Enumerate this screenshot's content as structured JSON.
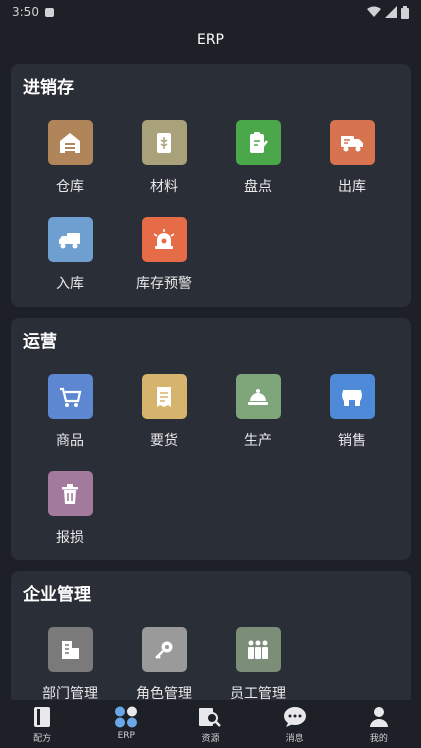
{
  "status": {
    "time": "3:50"
  },
  "header": {
    "title": "ERP"
  },
  "sections": [
    {
      "title": "进销存",
      "items": [
        {
          "label": "仓库",
          "icon": "warehouse-icon",
          "color": "#b0855a"
        },
        {
          "label": "材料",
          "icon": "material-icon",
          "color": "#a8a17a"
        },
        {
          "label": "盘点",
          "icon": "inventory-check-icon",
          "color": "#4aa84a"
        },
        {
          "label": "出库",
          "icon": "outbound-truck-icon",
          "color": "#d8734f"
        },
        {
          "label": "入库",
          "icon": "inbound-truck-icon",
          "color": "#6f9fd0"
        },
        {
          "label": "库存预警",
          "icon": "alarm-icon",
          "color": "#e66c48"
        }
      ]
    },
    {
      "title": "运营",
      "items": [
        {
          "label": "商品",
          "icon": "cart-icon",
          "color": "#5d87d0"
        },
        {
          "label": "要货",
          "icon": "receipt-icon",
          "color": "#d7b46e"
        },
        {
          "label": "生产",
          "icon": "production-icon",
          "color": "#7fa57a"
        },
        {
          "label": "销售",
          "icon": "store-icon",
          "color": "#4f8ad8"
        },
        {
          "label": "报损",
          "icon": "trash-icon",
          "color": "#a27a9c"
        }
      ]
    },
    {
      "title": "企业管理",
      "items": [
        {
          "label": "部门管理",
          "icon": "department-icon",
          "color": "#7a7a7a"
        },
        {
          "label": "角色管理",
          "icon": "key-icon",
          "color": "#9a9a9a"
        },
        {
          "label": "员工管理",
          "icon": "staff-icon",
          "color": "#7c8e77"
        }
      ]
    }
  ],
  "tabs": [
    {
      "label": "配方",
      "icon": "book-icon"
    },
    {
      "label": "ERP",
      "icon": "erp-icon",
      "active": true
    },
    {
      "label": "资源",
      "icon": "resource-search-icon"
    },
    {
      "label": "消息",
      "icon": "message-icon"
    },
    {
      "label": "我的",
      "icon": "profile-icon"
    }
  ]
}
